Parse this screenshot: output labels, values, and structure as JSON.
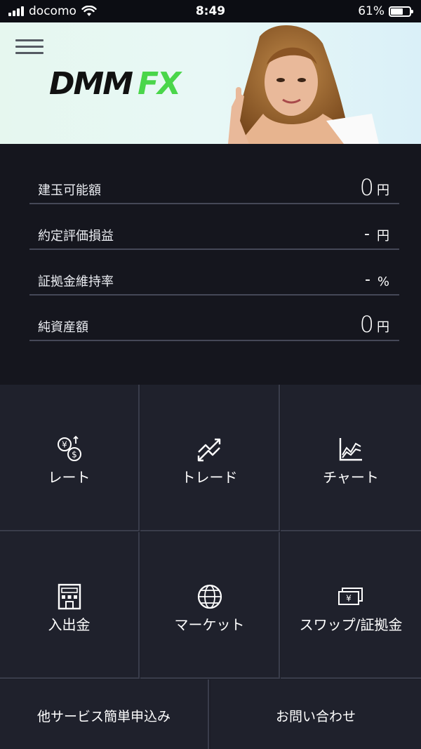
{
  "status_bar": {
    "carrier": "docomo",
    "time": "8:49",
    "battery": "61%",
    "battery_level": 0.61
  },
  "header": {
    "logo_primary": "DMM",
    "logo_accent": "FX",
    "logo_accent_color": "#4ad64a",
    "menu_icon": "hamburger-icon"
  },
  "summary": {
    "rows": [
      {
        "label": "建玉可能額",
        "value": "0",
        "unit": "円"
      },
      {
        "label": "約定評価損益",
        "value": "-",
        "unit": "円"
      },
      {
        "label": "証拠金維持率",
        "value": "-",
        "unit": "%"
      },
      {
        "label": "純資産額",
        "value": "0",
        "unit": "円"
      }
    ]
  },
  "menu": {
    "tiles": [
      {
        "label": "レート",
        "icon": "currency-exchange-icon"
      },
      {
        "label": "トレード",
        "icon": "trade-arrows-icon"
      },
      {
        "label": "チャート",
        "icon": "chart-icon"
      },
      {
        "label": "入出金",
        "icon": "bank-building-icon"
      },
      {
        "label": "マーケット",
        "icon": "globe-icon"
      },
      {
        "label": "スワップ/証拠金",
        "icon": "yen-banknote-icon"
      }
    ],
    "bottom": [
      {
        "label": "他サービス簡単申込み"
      },
      {
        "label": "お問い合わせ"
      }
    ]
  },
  "colors": {
    "background": "#15161e",
    "tile": "#1f212c",
    "divider": "#3a3d4b",
    "text": "#ffffff"
  }
}
